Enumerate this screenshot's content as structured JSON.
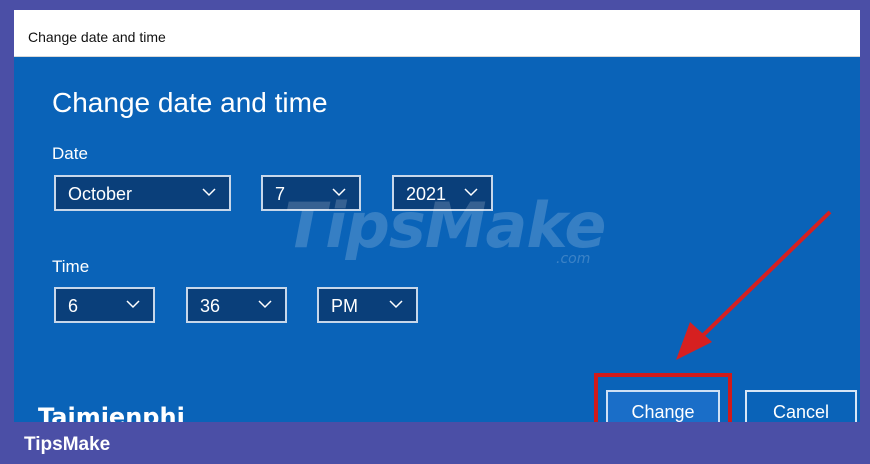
{
  "window": {
    "title": "Change date and time"
  },
  "dialog": {
    "heading": "Change date and time",
    "date_label": "Date",
    "time_label": "Time",
    "date_fields": {
      "month": "October",
      "day": "7",
      "year": "2021"
    },
    "time_fields": {
      "hour": "6",
      "minute": "36",
      "ampm": "PM"
    },
    "buttons": {
      "change": "Change",
      "cancel": "Cancel"
    }
  },
  "watermark": {
    "text": "TipsMake",
    "suffix": ".com",
    "bottom_logo": "Taimienphi"
  },
  "footer": {
    "brand": "TipsMake"
  },
  "colors": {
    "dialog_bg": "#0a63b8",
    "frame": "#4b4fa6",
    "highlight": "#d11a1a"
  }
}
